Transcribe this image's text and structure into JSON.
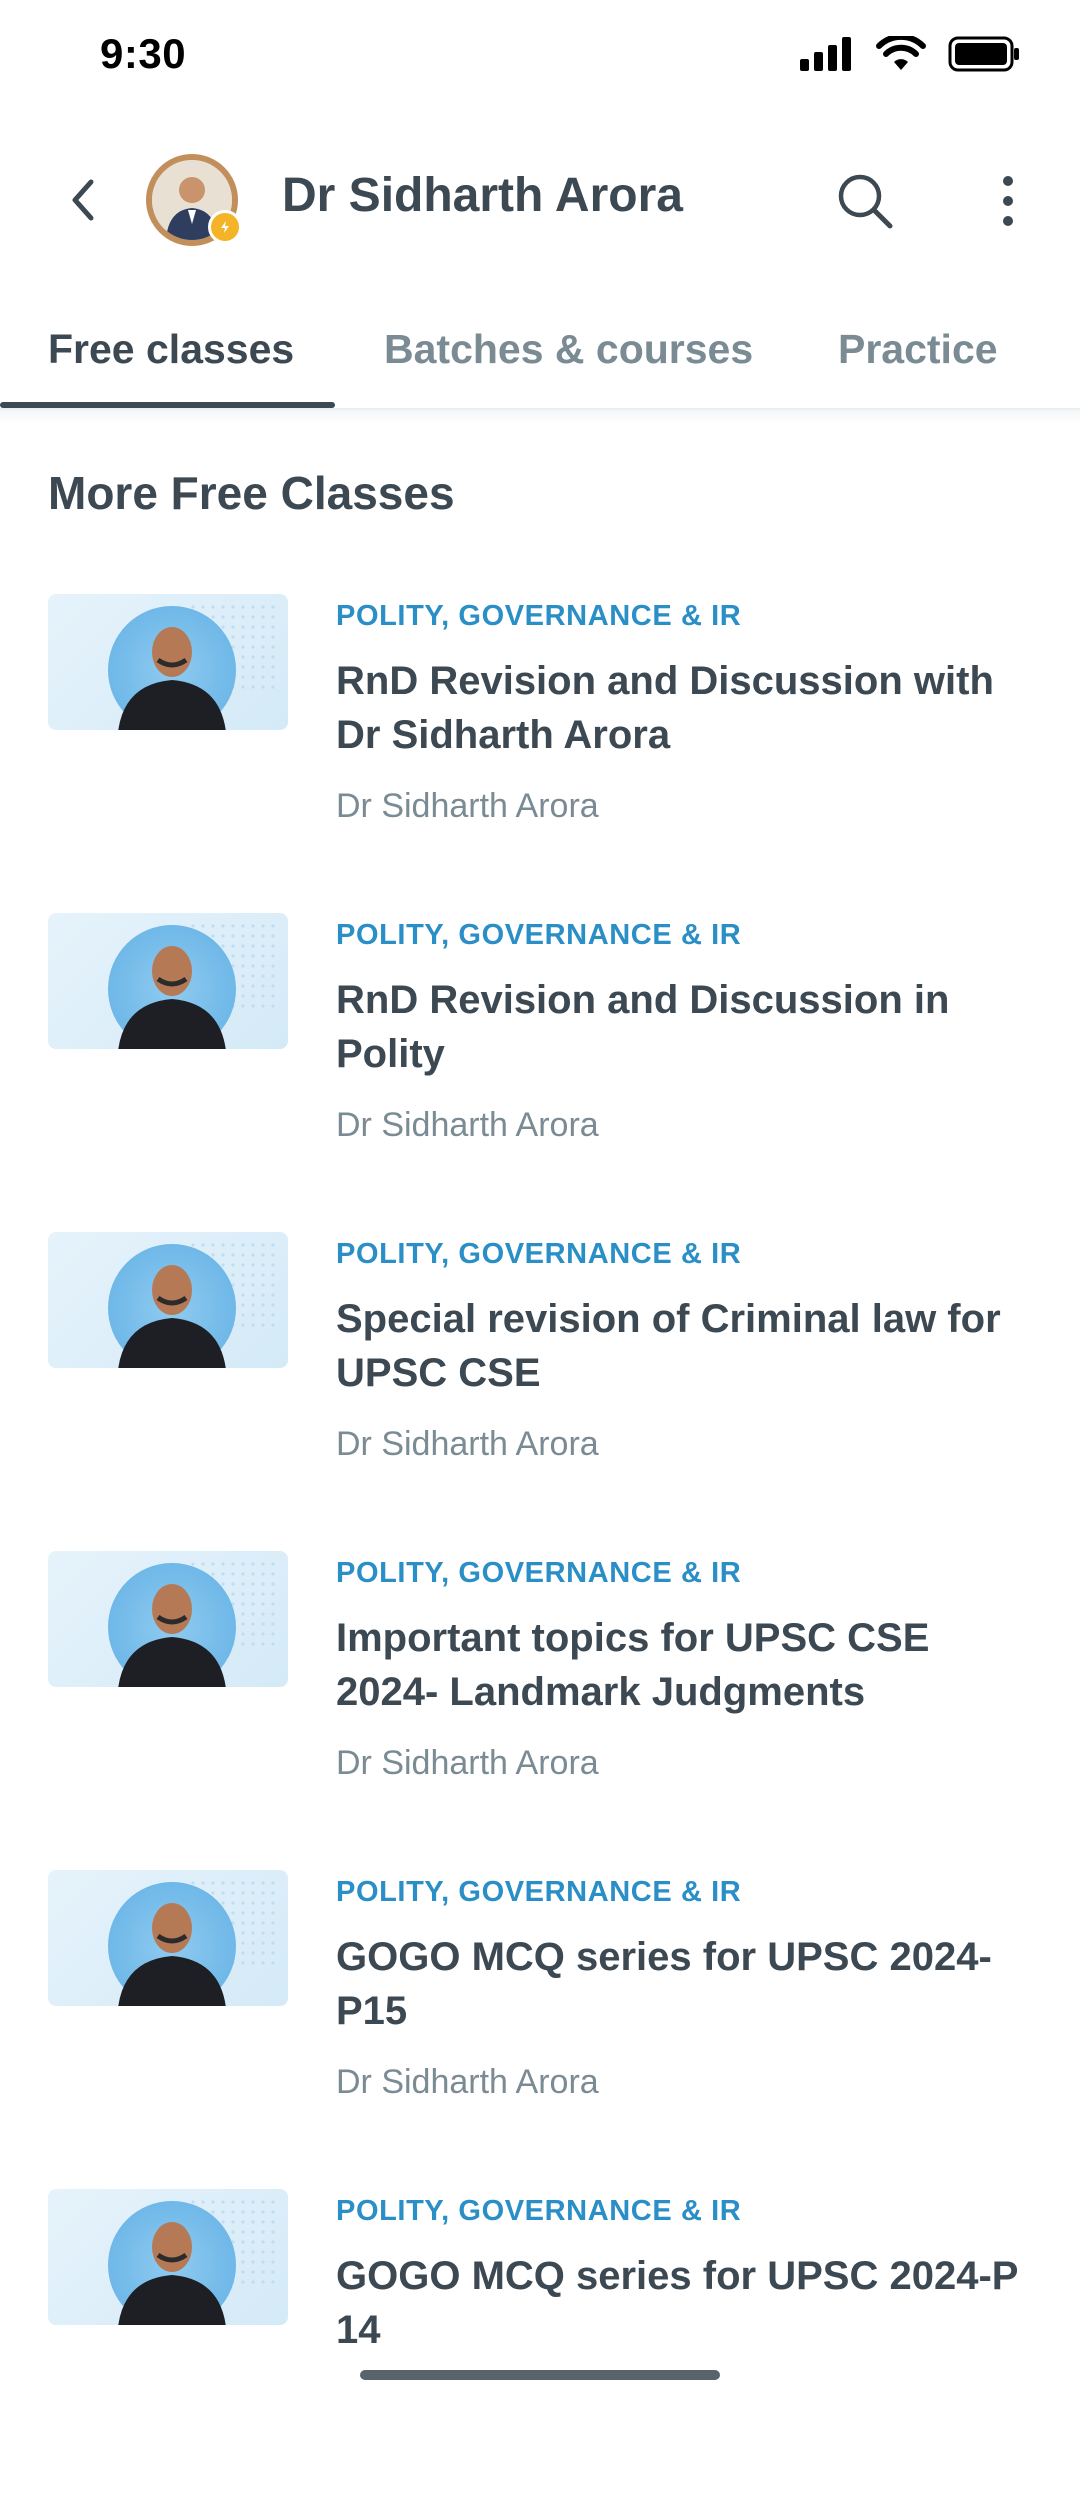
{
  "status_bar": {
    "time": "9:30"
  },
  "header": {
    "title": "Dr Sidharth Arora",
    "back_icon": "chevron-left-icon",
    "search_icon": "search-icon",
    "more_icon": "more-vertical-icon"
  },
  "tabs": [
    {
      "label": "Free classes",
      "active": true
    },
    {
      "label": "Batches & courses",
      "active": false
    },
    {
      "label": "Practice",
      "active": false
    }
  ],
  "section": {
    "title": "More Free Classes"
  },
  "items": [
    {
      "category": "POLITY, GOVERNANCE & IR",
      "title": "RnD Revision and Discussion with Dr Sidharth Arora",
      "author": "Dr Sidharth Arora"
    },
    {
      "category": "POLITY, GOVERNANCE & IR",
      "title": "RnD Revision and Discussion in Polity",
      "author": "Dr Sidharth Arora"
    },
    {
      "category": "POLITY, GOVERNANCE & IR",
      "title": "Special revision of Criminal law for UPSC CSE",
      "author": "Dr Sidharth Arora"
    },
    {
      "category": "POLITY, GOVERNANCE & IR",
      "title": "Important topics for UPSC CSE 2024- Landmark Judgments",
      "author": "Dr Sidharth Arora"
    },
    {
      "category": "POLITY, GOVERNANCE & IR",
      "title": "GOGO MCQ series for UPSC 2024-P15",
      "author": "Dr Sidharth Arora"
    },
    {
      "category": "POLITY, GOVERNANCE & IR",
      "title": "GOGO MCQ series for UPSC 2024-P 14",
      "author": ""
    }
  ],
  "colors": {
    "text_primary": "#3c4852",
    "text_secondary": "#7a8b94",
    "category": "#2a8ec7"
  }
}
